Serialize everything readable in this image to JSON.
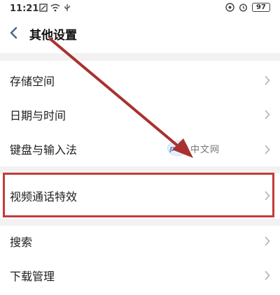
{
  "status_bar": {
    "time": "11:21",
    "left_icons": [
      "no-sim-icon",
      "wifi-icon",
      "usb-icon"
    ],
    "right_icons": [
      "nfc-icon",
      "alarm-icon"
    ],
    "battery": "97"
  },
  "header": {
    "back_icon": "chevron-left-icon",
    "title": "其他设置"
  },
  "settings": {
    "items": [
      {
        "label": "存储空间"
      },
      {
        "label": "日期与时间"
      },
      {
        "label": "键盘与输入法"
      },
      {
        "label": "视频通话特效"
      },
      {
        "label": "搜索"
      },
      {
        "label": "下载管理"
      }
    ]
  },
  "watermark": {
    "logo": "php",
    "text": "中文网"
  },
  "colors": {
    "annotation": "#c53a3a",
    "background": "#ffffff",
    "band": "#f2f2f2"
  }
}
